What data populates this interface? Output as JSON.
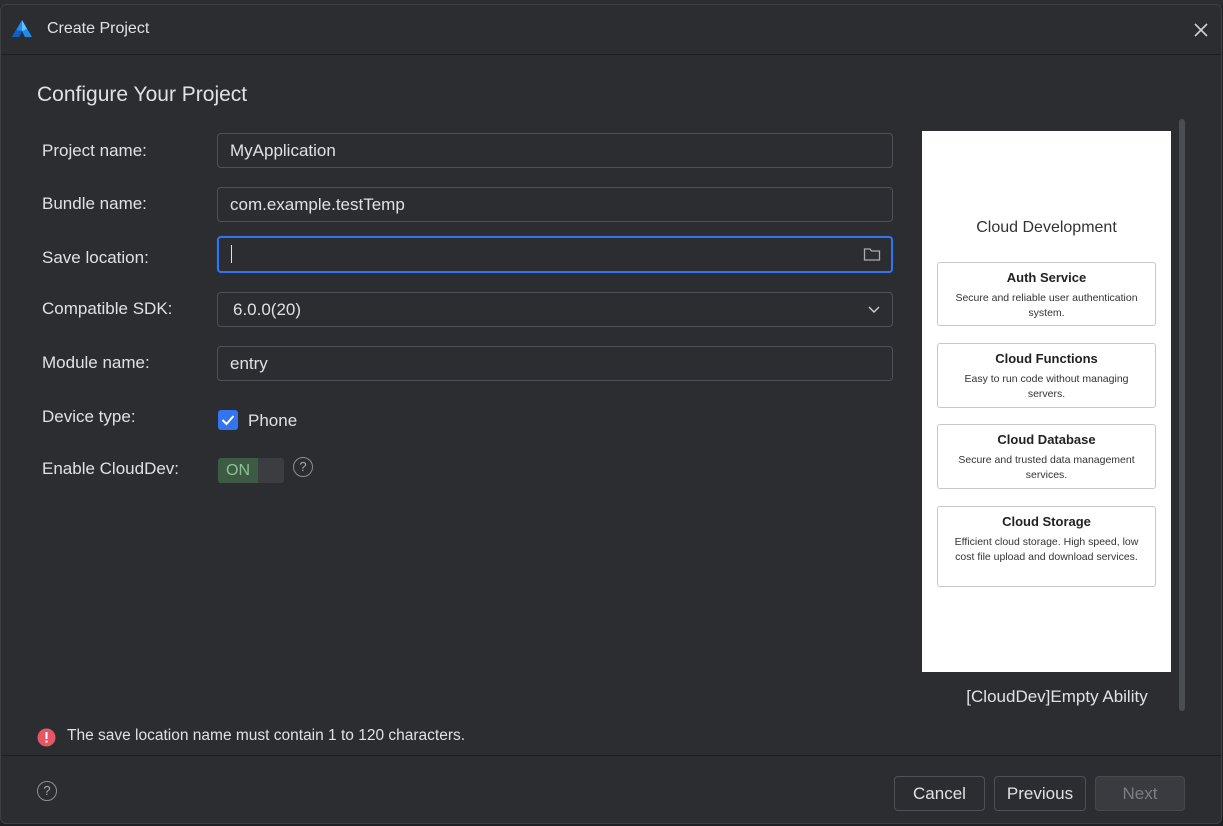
{
  "dialog": {
    "title": "Create Project",
    "heading": "Configure Your Project"
  },
  "form": {
    "project_name": {
      "label": "Project name:",
      "value": "MyApplication"
    },
    "bundle_name": {
      "label": "Bundle name:",
      "value": "com.example.testTemp"
    },
    "save_location": {
      "label": "Save location:",
      "value": ""
    },
    "compatible_sdk": {
      "label": "Compatible SDK:",
      "value": "6.0.0(20)"
    },
    "module_name": {
      "label": "Module name:",
      "value": "entry"
    },
    "device_type": {
      "label": "Device type:",
      "option": "Phone",
      "checked": true
    },
    "enable_clouddev": {
      "label": "Enable CloudDev:",
      "state": "ON",
      "help": "?"
    }
  },
  "preview": {
    "title": "Cloud Development",
    "cards": [
      {
        "title": "Auth Service",
        "desc": "Secure and reliable user authentication system."
      },
      {
        "title": "Cloud Functions",
        "desc": "Easy to run code without managing servers."
      },
      {
        "title": "Cloud Database",
        "desc": "Secure and trusted data management services."
      },
      {
        "title": "Cloud Storage",
        "desc": "Efficient cloud storage. High speed, low cost file upload and download services."
      }
    ],
    "template_name": "[CloudDev]Empty Ability"
  },
  "error": {
    "message": "The save location name must contain 1 to 120 characters."
  },
  "footer": {
    "help": "?",
    "cancel_label": "Cancel",
    "previous_label": "Previous",
    "next_label": "Next"
  },
  "colors": {
    "accent": "#3574f0",
    "error": "#e55765",
    "toggle_on": "#3d5a45"
  },
  "icons": [
    "app-logo-icon",
    "close-icon",
    "folder-icon",
    "chevron-down-icon",
    "checkmark-icon",
    "help-icon",
    "error-icon"
  ]
}
